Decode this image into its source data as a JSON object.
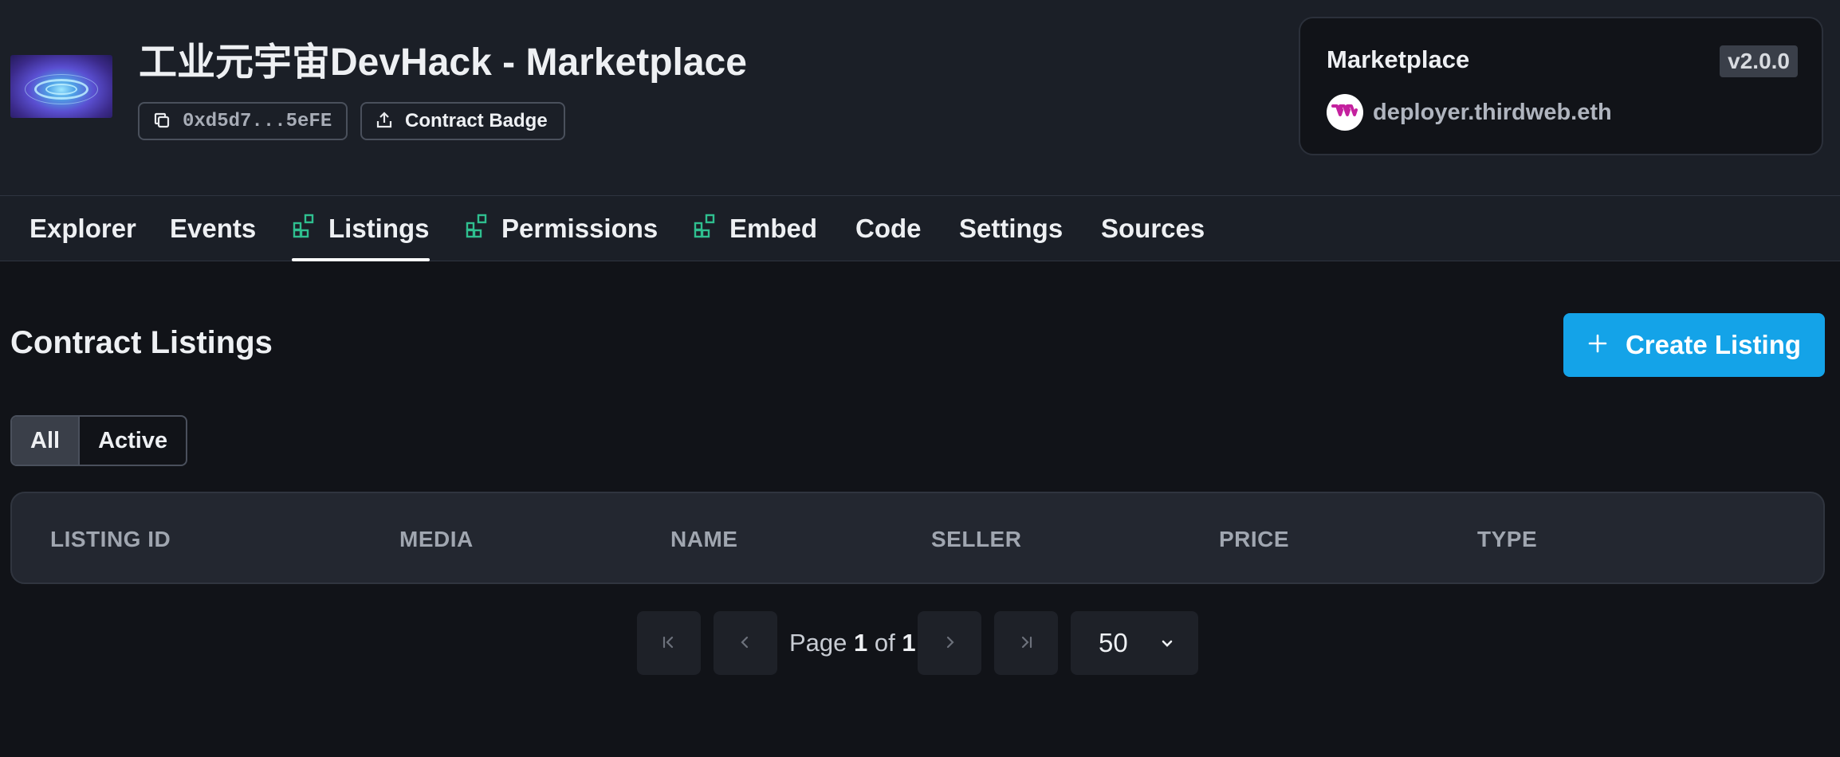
{
  "header": {
    "title": "工业元宇宙DevHack - Marketplace",
    "address": "0xd5d7...5eFE",
    "badge_label": "Contract Badge"
  },
  "card": {
    "title": "Marketplace",
    "version": "v2.0.0",
    "deployer": "deployer.thirdweb.eth"
  },
  "tabs": [
    {
      "label": "Explorer",
      "icon": null
    },
    {
      "label": "Events",
      "icon": null
    },
    {
      "label": "Listings",
      "icon": "extension-icon",
      "active": true
    },
    {
      "label": "Permissions",
      "icon": "extension-icon"
    },
    {
      "label": "Embed",
      "icon": "extension-icon"
    },
    {
      "label": "Code",
      "icon": null
    },
    {
      "label": "Settings",
      "icon": null
    },
    {
      "label": "Sources",
      "icon": null
    }
  ],
  "listings": {
    "title": "Contract Listings",
    "create_label": "Create Listing",
    "filters": [
      "All",
      "Active"
    ],
    "selected_filter": "All",
    "columns": [
      "LISTING ID",
      "MEDIA",
      "NAME",
      "SELLER",
      "PRICE",
      "TYPE"
    ],
    "rows": []
  },
  "pagination": {
    "page_word": "Page",
    "current": "1",
    "of_word": "of",
    "total": "1",
    "page_size": "50"
  },
  "colors": {
    "accent": "#14a3e8",
    "extension_icon": "#2fbf8f",
    "background": "#111318",
    "header_background": "#1b1f27"
  }
}
